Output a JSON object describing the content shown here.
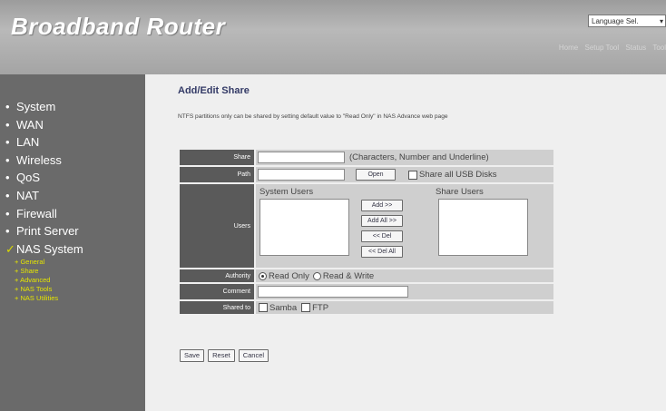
{
  "header": {
    "brand": "Broadband Router",
    "language_select": "Language Sel.",
    "top_links": [
      "Home",
      "Setup Tool",
      "Status",
      "Tool"
    ]
  },
  "sidebar": {
    "items": [
      {
        "label": "System"
      },
      {
        "label": "WAN"
      },
      {
        "label": "LAN"
      },
      {
        "label": "Wireless"
      },
      {
        "label": "QoS"
      },
      {
        "label": "NAT"
      },
      {
        "label": "Firewall"
      },
      {
        "label": "Print Server"
      },
      {
        "label": "NAS System"
      }
    ],
    "subitems": [
      {
        "label": "General"
      },
      {
        "label": "Share"
      },
      {
        "label": "Advanced"
      },
      {
        "label": "NAS Tools"
      },
      {
        "label": "NAS Utilities"
      }
    ]
  },
  "main": {
    "title": "Add/Edit Share",
    "note": "NTFS partitions only can be shared by setting default value to \"Read Only\" in NAS Advance web page",
    "form": {
      "share_label": "Share",
      "share_value": "",
      "share_hint": "(Characters, Number and Underline)",
      "path_label": "Path",
      "path_value": "",
      "open_button": "Open",
      "share_all_usb": "Share all USB Disks",
      "users_label": "Users",
      "system_users_label": "System Users",
      "share_users_label": "Share Users",
      "add_button": "Add >>",
      "add_all_button": "Add All >>",
      "del_button": "<< Del",
      "del_all_button": "<< Del All",
      "authority_label": "Authority",
      "read_only": "Read Only",
      "read_write": "Read & Write",
      "comment_label": "Comment",
      "comment_value": "",
      "shared_to_label": "Shared to",
      "samba": "Samba",
      "ftp": "FTP"
    },
    "buttons": {
      "save": "Save",
      "reset": "Reset",
      "cancel": "Cancel"
    }
  }
}
